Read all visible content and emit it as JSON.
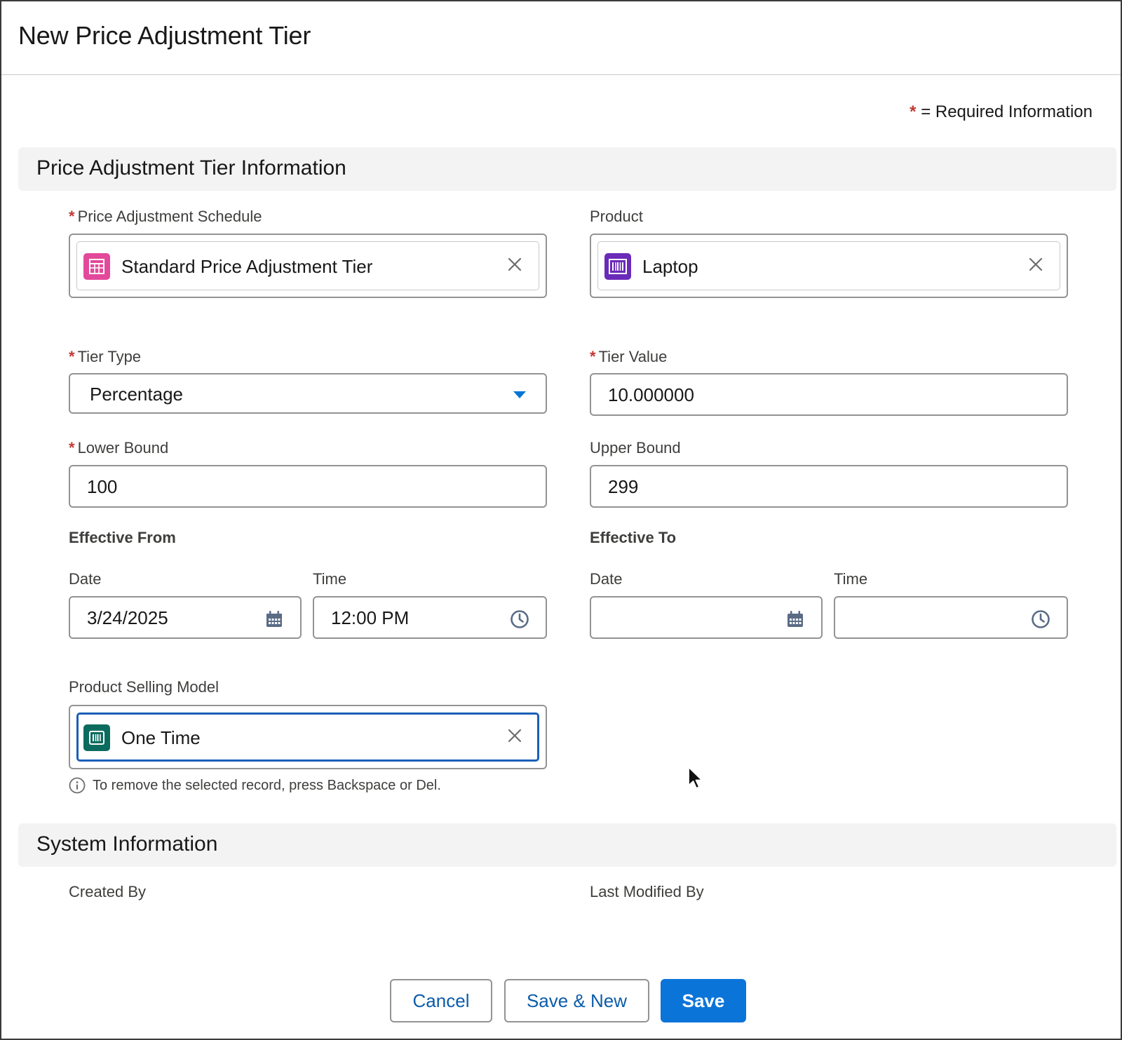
{
  "modal": {
    "title": "New Price Adjustment Tier",
    "required_note_star": "*",
    "required_note": "= Required Information"
  },
  "sections": {
    "info_title": "Price Adjustment Tier Information",
    "system_title": "System Information"
  },
  "fields": {
    "schedule": {
      "label": "Price Adjustment Schedule",
      "value": "Standard Price Adjustment Tier",
      "required": true,
      "icon": "price-adjustment-schedule-icon",
      "icon_color": "#e3499a"
    },
    "product": {
      "label": "Product",
      "value": "Laptop",
      "required": false,
      "icon": "product-barcode-icon",
      "icon_color": "#6a2bb8"
    },
    "tier_type": {
      "label": "Tier Type",
      "value": "Percentage",
      "required": true
    },
    "tier_value": {
      "label": "Tier Value",
      "value": "10.000000",
      "required": true
    },
    "lower_bound": {
      "label": "Lower Bound",
      "value": "100",
      "required": true
    },
    "upper_bound": {
      "label": "Upper Bound",
      "value": "299",
      "required": false
    },
    "effective_from": {
      "heading": "Effective From",
      "date_label": "Date",
      "date_value": "3/24/2025",
      "time_label": "Time",
      "time_value": "12:00 PM"
    },
    "effective_to": {
      "heading": "Effective To",
      "date_label": "Date",
      "date_value": "",
      "time_label": "Time",
      "time_value": ""
    },
    "selling_model": {
      "label": "Product Selling Model",
      "value": "One Time",
      "icon": "product-selling-model-icon",
      "icon_color": "#0b6b5e",
      "help": "To remove the selected record, press Backspace or Del."
    }
  },
  "system": {
    "created_by_label": "Created By",
    "modified_by_label": "Last Modified By"
  },
  "buttons": {
    "cancel": "Cancel",
    "save_new": "Save & New",
    "save": "Save"
  },
  "colors": {
    "brand": "#0b74d9",
    "required": "#c23934",
    "focus": "#1b5fb8"
  }
}
